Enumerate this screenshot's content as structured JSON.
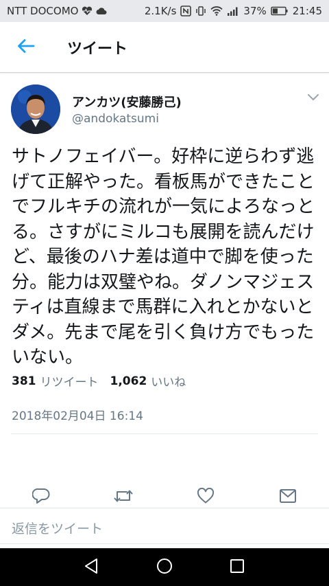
{
  "status_bar": {
    "carrier": "NTT DOCOMO",
    "speed": "2.1K/s",
    "battery": "37%",
    "time": "21:45"
  },
  "header": {
    "title": "ツイート"
  },
  "tweet": {
    "author_name": "アンカツ(安藤勝己)",
    "author_handle": "@andokatsumi",
    "text": "サトノフェイバー。好枠に逆らわず逃げて正解やった。看板馬ができたことでフルキチの流れが一気によろなっとる。さすがにミルコも展開を読んだけど、最後のハナ差は道中で脚を使った分。能力は双璧やね。ダノンマジェスティは直線まで馬群に入れとかないとダメ。先まで尾を引く負け方でもったいない。",
    "date": "2018年02月04日 16:14"
  },
  "stats": {
    "retweets_count": "381",
    "retweets_label": "リツイート",
    "likes_count": "1,062",
    "likes_label": "いいね"
  },
  "reply": {
    "placeholder": "返信をツイート"
  },
  "colors": {
    "accent": "#1da1f2",
    "muted": "#657786"
  }
}
